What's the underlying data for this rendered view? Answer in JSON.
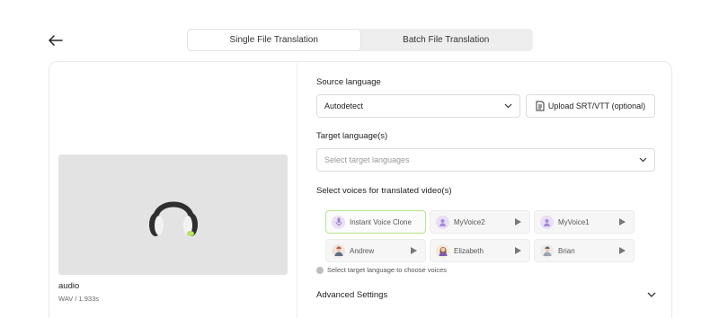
{
  "tabs": [
    {
      "label": "Single File Translation",
      "active": true
    },
    {
      "label": "Batch File Translation",
      "active": false
    }
  ],
  "media": {
    "name": "audio",
    "meta": "WAV / 1.933s",
    "icon": "headphones-icon"
  },
  "source": {
    "label": "Source language",
    "value": "Autodetect"
  },
  "upload": {
    "label": "Upload SRT/VTT (optional)"
  },
  "target": {
    "label": "Target language(s)",
    "placeholder": "Select target languages"
  },
  "voices": {
    "label": "Select voices for translated video(s)",
    "items": [
      {
        "name": "Instant Voice Clone",
        "selected": true
      },
      {
        "name": "MyVoice2",
        "selected": false
      },
      {
        "name": "MyVoice1",
        "selected": false
      },
      {
        "name": "Andrew",
        "selected": false
      },
      {
        "name": "Elizabeth",
        "selected": false
      },
      {
        "name": "Brian",
        "selected": false
      }
    ],
    "hint": "Select target language to choose voices"
  },
  "advanced": {
    "label": "Advanced Settings"
  },
  "colors": {
    "accent_selected_border": "#b9e58a",
    "tab_bg": "#eeeeee",
    "media_bg": "#e3e3e3"
  }
}
